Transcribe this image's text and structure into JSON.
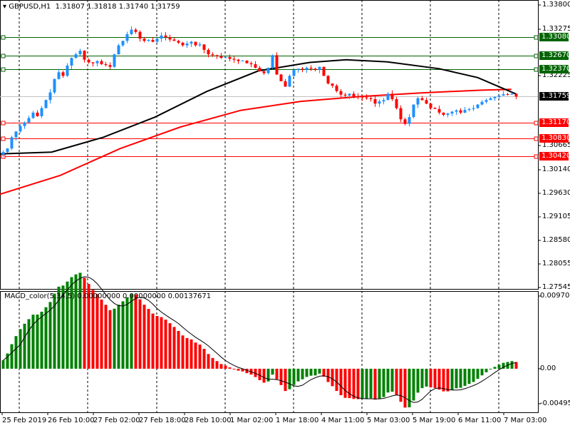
{
  "header": {
    "symbol": "GBPUSD,H1",
    "ohlc": "1.31807 1.31818 1.31740 1.31759"
  },
  "macd_header": "MACD_color(5,34,5) 0.00000000 0.00000000 0.00137671",
  "colors": {
    "bull": "#1e90ff",
    "bear": "#ff0000",
    "green": "#008000",
    "red": "#ff0000",
    "ma_fast": "#000000",
    "ma_slow": "#ff0000"
  },
  "chart_data": [
    {
      "type": "candlestick",
      "title": "GBPUSD,H1",
      "ylim": [
        1.27545,
        1.338
      ],
      "y_ticks": [
        "1.33800",
        "1.33275",
        "1.32750",
        "1.32225",
        "1.31700",
        "1.30665",
        "1.30140",
        "1.29630",
        "1.29105",
        "1.28580",
        "1.28055",
        "1.27545"
      ],
      "x_ticks": [
        "25 Feb 2019",
        "26 Feb 10:00",
        "27 Feb 02:00",
        "27 Feb 18:00",
        "28 Feb 10:00",
        "1 Mar 02:00",
        "1 Mar 18:00",
        "4 Mar 11:00",
        "5 Mar 03:00",
        "5 Mar 19:00",
        "6 Mar 11:00",
        "7 Mar 03:00"
      ],
      "closes": [
        1.3052,
        1.306,
        1.3085,
        1.3098,
        1.311,
        1.3118,
        1.3128,
        1.314,
        1.3132,
        1.315,
        1.3168,
        1.3185,
        1.3215,
        1.323,
        1.3222,
        1.3245,
        1.3262,
        1.327,
        1.3278,
        1.3258,
        1.3252,
        1.325,
        1.3255,
        1.3248,
        1.3246,
        1.3242,
        1.327,
        1.329,
        1.33,
        1.3315,
        1.3325,
        1.332,
        1.3305,
        1.33,
        1.3302,
        1.3298,
        1.3305,
        1.3312,
        1.3308,
        1.3303,
        1.33,
        1.3296,
        1.329,
        1.3294,
        1.3298,
        1.329,
        1.3292,
        1.328,
        1.327,
        1.3268,
        1.3266,
        1.3262,
        1.3264,
        1.326,
        1.3258,
        1.3255,
        1.3256,
        1.325,
        1.3248,
        1.324,
        1.3232,
        1.3228,
        1.324,
        1.3268,
        1.3225,
        1.321,
        1.3198,
        1.3222,
        1.3235,
        1.3238,
        1.3236,
        1.324,
        1.3238,
        1.3235,
        1.3242,
        1.3222,
        1.3205,
        1.32,
        1.3188,
        1.318,
        1.3178,
        1.3182,
        1.3176,
        1.3175,
        1.3174,
        1.3172,
        1.317,
        1.316,
        1.3165,
        1.3168,
        1.3182,
        1.317,
        1.315,
        1.3125,
        1.3115,
        1.313,
        1.3158,
        1.3172,
        1.3168,
        1.316,
        1.315,
        1.3148,
        1.314,
        1.3135,
        1.3138,
        1.3142,
        1.3145,
        1.314,
        1.3146,
        1.3148,
        1.315,
        1.3158,
        1.3164,
        1.3168,
        1.3172,
        1.3175,
        1.3178,
        1.3181,
        1.318,
        1.3182,
        1.31759
      ],
      "ma_fast": [
        [
          0,
          1.3048
        ],
        [
          20,
          1.3052
        ],
        [
          40,
          1.3085
        ],
        [
          60,
          1.313
        ],
        [
          80,
          1.3187
        ],
        [
          100,
          1.3233
        ],
        [
          120,
          1.3252
        ],
        [
          134,
          1.3258
        ],
        [
          150,
          1.3253
        ],
        [
          170,
          1.3238
        ],
        [
          185,
          1.3218
        ],
        [
          200,
          1.3181
        ]
      ],
      "ma_slow": [
        [
          0,
          1.2958
        ],
        [
          20,
          1.3
        ],
        [
          40,
          1.306
        ],
        [
          60,
          1.3108
        ],
        [
          80,
          1.3145
        ],
        [
          100,
          1.3165
        ],
        [
          120,
          1.3176
        ],
        [
          140,
          1.3184
        ],
        [
          160,
          1.319
        ],
        [
          170,
          1.3192
        ]
      ],
      "levels": [
        {
          "label": "1.33080",
          "value": 1.3308,
          "color": "#006400"
        },
        {
          "label": "1.32670",
          "value": 1.3267,
          "color": "#006400"
        },
        {
          "label": "1.32370",
          "value": 1.3237,
          "color": "#006400"
        },
        {
          "label": "1.31170",
          "value": 1.3117,
          "color": "#ff0000"
        },
        {
          "label": "1.30830",
          "value": 1.3083,
          "color": "#ff0000"
        },
        {
          "label": "1.30420",
          "value": 1.3042,
          "color": "#ff0000"
        }
      ],
      "bid": {
        "label": "1.31759",
        "value": 1.31759
      }
    },
    {
      "type": "bar",
      "title": "MACD_color(5,34,5)",
      "ylim": [
        -0.004958,
        0.0097046
      ],
      "y_ticks": [
        "0.0097046",
        "0.00",
        "-0.004958"
      ],
      "fast": 5,
      "slow": 34,
      "signal": 5
    }
  ]
}
